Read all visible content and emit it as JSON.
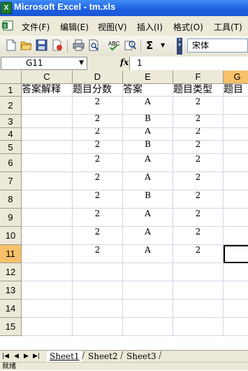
{
  "window": {
    "title": "Microsoft Excel - tm.xls",
    "app_icon": "X"
  },
  "menu": [
    "文件(F)",
    "编辑(E)",
    "视图(V)",
    "插入(I)",
    "格式(O)",
    "工具(T)"
  ],
  "toolbar": {
    "icons": [
      "new-icon",
      "open-icon",
      "save-icon",
      "permission-icon",
      "print-icon",
      "print-preview-icon",
      "spelling-icon",
      "research-icon",
      "autosum-icon"
    ],
    "autosum_label": "Σ",
    "font_name": "宋体"
  },
  "formula_bar": {
    "name_box": "G11",
    "fx_label": "fx",
    "value": "1"
  },
  "columns": [
    "C",
    "D",
    "E",
    "F",
    "G"
  ],
  "rows": [
    {
      "num": "1",
      "cells": [
        "答案解释",
        "题目分数",
        "答案",
        "题目类型",
        "题目"
      ]
    },
    {
      "num": "2",
      "cells": [
        "",
        "2",
        "A",
        "2",
        ""
      ]
    },
    {
      "num": "3",
      "cells": [
        "",
        "2",
        "B",
        "2",
        ""
      ]
    },
    {
      "num": "4",
      "cells": [
        "",
        "2",
        "A",
        "2",
        ""
      ]
    },
    {
      "num": "5",
      "cells": [
        "",
        "2",
        "B",
        "2",
        ""
      ]
    },
    {
      "num": "6",
      "cells": [
        "",
        "2",
        "A",
        "2",
        ""
      ]
    },
    {
      "num": "7",
      "cells": [
        "",
        "2",
        "A",
        "2",
        ""
      ]
    },
    {
      "num": "8",
      "cells": [
        "",
        "2",
        "B",
        "2",
        ""
      ]
    },
    {
      "num": "9",
      "cells": [
        "",
        "2",
        "A",
        "2",
        ""
      ]
    },
    {
      "num": "10",
      "cells": [
        "",
        "2",
        "A",
        "2",
        ""
      ]
    },
    {
      "num": "11",
      "cells": [
        "",
        "2",
        "A",
        "2",
        ""
      ]
    },
    {
      "num": "12",
      "cells": [
        "",
        "",
        "",
        "",
        ""
      ]
    },
    {
      "num": "13",
      "cells": [
        "",
        "",
        "",
        "",
        ""
      ]
    },
    {
      "num": "14",
      "cells": [
        "",
        "",
        "",
        "",
        ""
      ]
    },
    {
      "num": "15",
      "cells": [
        "",
        "",
        "",
        "",
        ""
      ]
    }
  ],
  "selected": {
    "column": "G",
    "row": "11"
  },
  "sheets": [
    "Sheet1",
    "Sheet2",
    "Sheet3"
  ],
  "active_sheet": "Sheet1",
  "status": "就绪",
  "colors": {
    "selection_header": "#f7c06a",
    "titlebar": "#1c5de0"
  }
}
